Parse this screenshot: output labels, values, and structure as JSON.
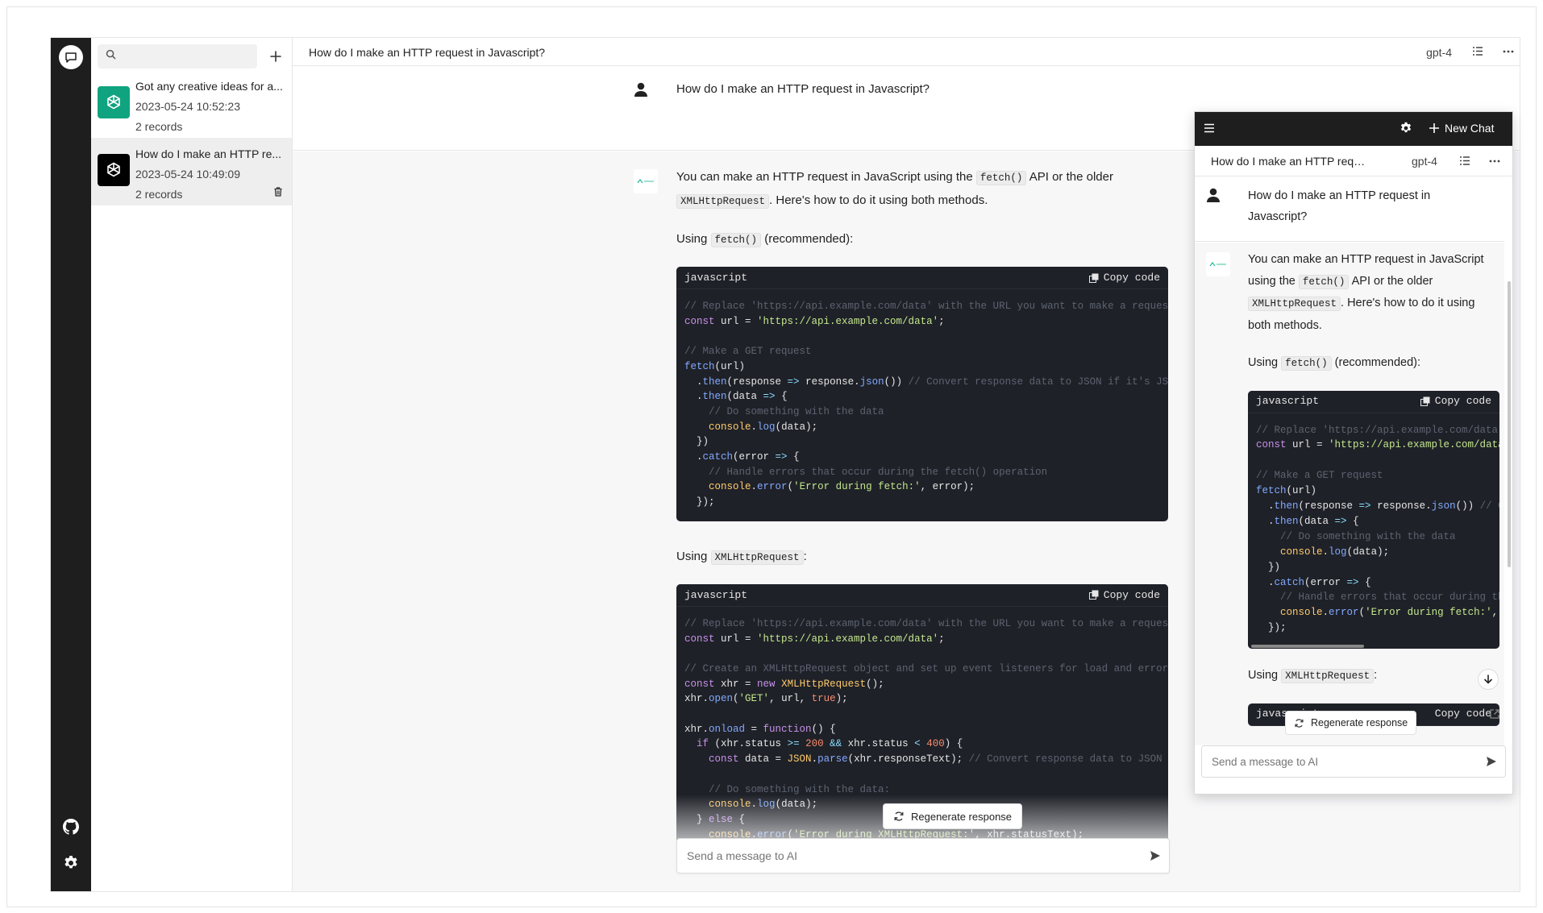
{
  "sidebar": {
    "search_placeholder": "",
    "conversations": [
      {
        "title": "Got any creative ideas for a...",
        "date": "2023-05-24 10:52:23",
        "records": "2 records",
        "avatar_color": "#10a37f"
      },
      {
        "title": "How do I make an HTTP re...",
        "date": "2023-05-24 10:49:09",
        "records": "2 records",
        "avatar_color": "#000000"
      }
    ]
  },
  "main": {
    "title": "How do I make an HTTP request in Javascript?",
    "model": "gpt-4",
    "user_message": "How do I make an HTTP request in Javascript?",
    "ai": {
      "intro_a": "You can make an HTTP request in JavaScript using the",
      "intro_code1": "fetch()",
      "intro_b": "API or the older",
      "intro_code2": "XMLHttpRequest",
      "intro_c": ". Here's how to do it using both methods.",
      "using1_a": "Using",
      "using1_code": "fetch()",
      "using1_b": "(recommended):",
      "using2_a": "Using",
      "using2_code": "XMLHttpRequest",
      "using2_b": ":",
      "code_lang": "javascript",
      "copy_label": "Copy code"
    },
    "regenerate_label": "Regenerate response",
    "composer_placeholder": "Send a message to AI"
  },
  "widget": {
    "new_chat_label": "New Chat",
    "title": "How do I make an HTTP request i...",
    "model": "gpt-4",
    "user_message": "How do I make an HTTP request in Javascript?",
    "regenerate_label": "Regenerate response",
    "composer_placeholder": "Send a message to AI"
  },
  "icons": [
    "chat-bubble-icon",
    "search-icon",
    "plus-icon",
    "openai-logo-icon",
    "trash-icon",
    "github-icon",
    "gear-icon",
    "list-icon",
    "more-icon",
    "user-icon",
    "share-icon",
    "copy-icon",
    "refresh-icon",
    "send-icon",
    "menu-icon",
    "arrow-down-icon"
  ],
  "colors": {
    "rail": "#1e1e1e",
    "code_bg": "#1f2128",
    "chat_bg": "#f7f7f8",
    "accent_green": "#10a37f"
  }
}
